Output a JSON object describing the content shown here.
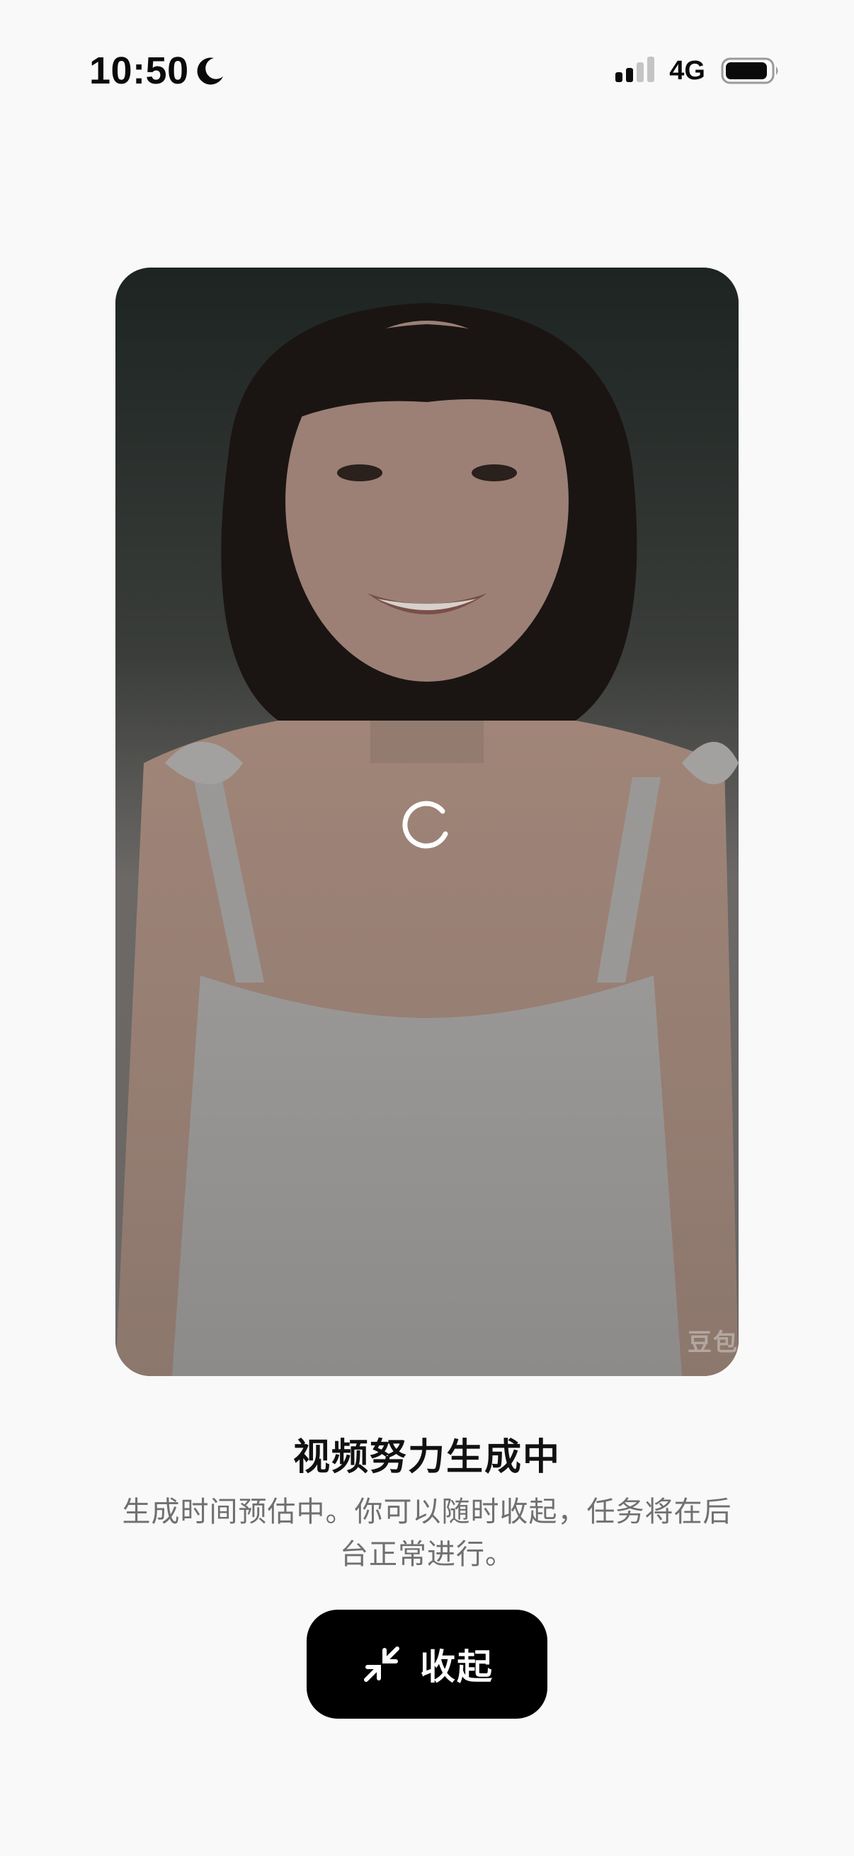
{
  "status_bar": {
    "time": "10:50",
    "network": "4G",
    "focus_icon": "moon-icon",
    "signal_icon": "cellular-signal-icon",
    "battery_icon": "battery-icon"
  },
  "preview": {
    "loading_icon": "loading-spinner-icon",
    "watermark": "豆包"
  },
  "content": {
    "title": "视频努力生成中",
    "description": "生成时间预估中。你可以随时收起，任务将在后台正常进行。"
  },
  "collapse_button": {
    "label": "收起",
    "icon": "minimize-arrows-icon",
    "background": "#000000",
    "text_color": "#ffffff"
  },
  "colors": {
    "page_background": "#f9f9f9",
    "description_text": "#707070"
  }
}
